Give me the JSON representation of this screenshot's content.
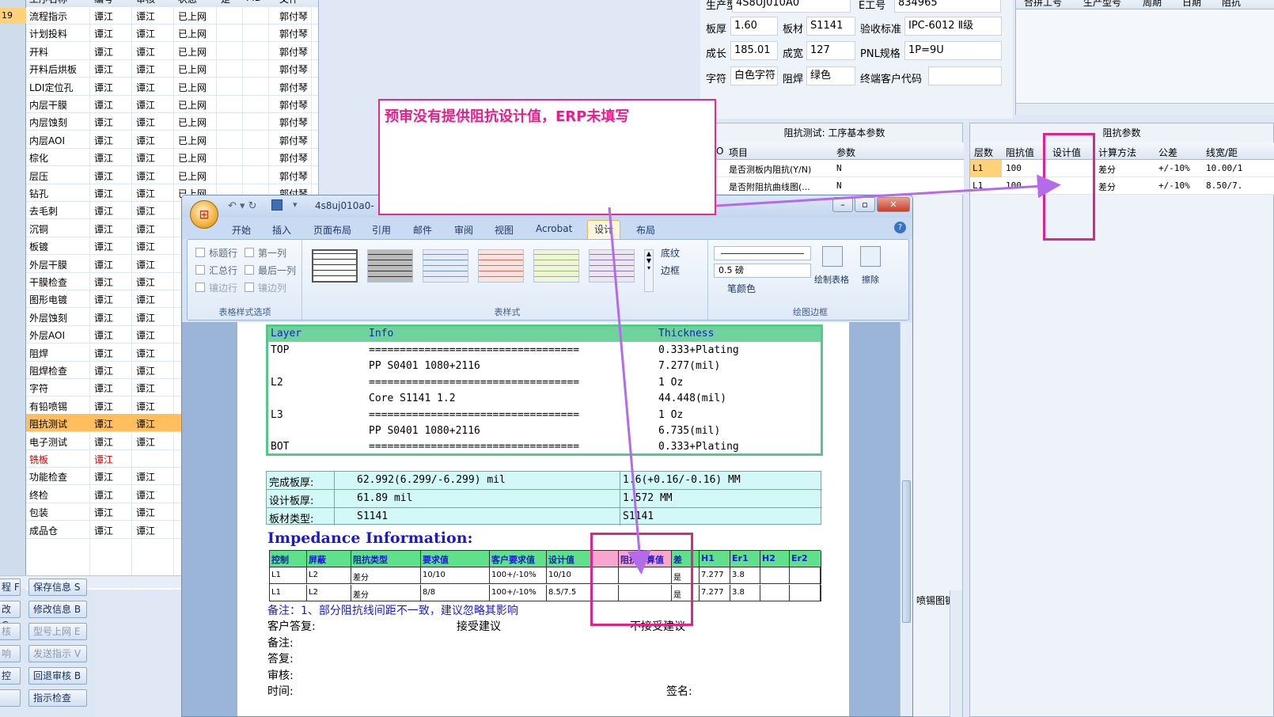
{
  "left_strip": {
    "selected_value": "19"
  },
  "process_grid": {
    "columns": [
      "工序名称",
      "编号",
      "审核",
      "状态",
      "是",
      "PID",
      "文件"
    ],
    "rows": [
      {
        "name": "流程指示",
        "a": "谭江",
        "b": "谭江",
        "c": "已上网",
        "d": "郭付琴"
      },
      {
        "name": "计划投料",
        "a": "谭江",
        "b": "谭江",
        "c": "已上网",
        "d": "郭付琴"
      },
      {
        "name": "开料",
        "a": "谭江",
        "b": "谭江",
        "c": "已上网",
        "d": "郭付琴"
      },
      {
        "name": "开料后烘板",
        "a": "谭江",
        "b": "谭江",
        "c": "已上网",
        "d": "郭付琴"
      },
      {
        "name": "LDI定位孔",
        "a": "谭江",
        "b": "谭江",
        "c": "已上网",
        "d": "郭付琴"
      },
      {
        "name": "内层干膜",
        "a": "谭江",
        "b": "谭江",
        "c": "已上网",
        "d": "郭付琴"
      },
      {
        "name": "内层蚀刻",
        "a": "谭江",
        "b": "谭江",
        "c": "已上网",
        "d": "郭付琴"
      },
      {
        "name": "内层AOI",
        "a": "谭江",
        "b": "谭江",
        "c": "已上网",
        "d": "郭付琴"
      },
      {
        "name": "棕化",
        "a": "谭江",
        "b": "谭江",
        "c": "已上网",
        "d": "郭付琴"
      },
      {
        "name": "层压",
        "a": "谭江",
        "b": "谭江",
        "c": "已上网",
        "d": "郭付琴"
      },
      {
        "name": "钻孔",
        "a": "谭江",
        "b": "谭江",
        "c": "已上网",
        "d": "郭付琴"
      },
      {
        "name": "去毛刺",
        "a": "谭江",
        "b": "谭江",
        "c": "",
        "d": ""
      },
      {
        "name": "沉铜",
        "a": "谭江",
        "b": "谭江",
        "c": "",
        "d": ""
      },
      {
        "name": "板镀",
        "a": "谭江",
        "b": "谭江",
        "c": "",
        "d": ""
      },
      {
        "name": "外层干膜",
        "a": "谭江",
        "b": "谭江",
        "c": "",
        "d": ""
      },
      {
        "name": "干膜检查",
        "a": "谭江",
        "b": "谭江",
        "c": "",
        "d": ""
      },
      {
        "name": "图形电镀",
        "a": "谭江",
        "b": "谭江",
        "c": "",
        "d": ""
      },
      {
        "name": "外层蚀刻",
        "a": "谭江",
        "b": "谭江",
        "c": "",
        "d": ""
      },
      {
        "name": "外层AOI",
        "a": "谭江",
        "b": "谭江",
        "c": "",
        "d": ""
      },
      {
        "name": "阻焊",
        "a": "谭江",
        "b": "谭江",
        "c": "",
        "d": ""
      },
      {
        "name": "阻焊检查",
        "a": "谭江",
        "b": "谭江",
        "c": "",
        "d": ""
      },
      {
        "name": "字符",
        "a": "谭江",
        "b": "谭江",
        "c": "",
        "d": ""
      },
      {
        "name": "有铅喷锡",
        "a": "谭江",
        "b": "谭江",
        "c": "",
        "d": ""
      },
      {
        "name": "阻抗测试",
        "a": "谭江",
        "b": "谭江",
        "c": "",
        "d": "",
        "highlight": true
      },
      {
        "name": "电子测试",
        "a": "谭江",
        "b": "谭江",
        "c": "",
        "d": ""
      },
      {
        "name": "铣板",
        "a": "谭江",
        "b": "",
        "c": "",
        "d": "",
        "red": true
      },
      {
        "name": "功能检查",
        "a": "谭江",
        "b": "谭江",
        "c": "",
        "d": ""
      },
      {
        "name": "终检",
        "a": "谭江",
        "b": "谭江",
        "c": "",
        "d": ""
      },
      {
        "name": "包装",
        "a": "谭江",
        "b": "谭江",
        "c": "",
        "d": ""
      },
      {
        "name": "成品仓",
        "a": "谭江",
        "b": "谭江",
        "c": "",
        "d": ""
      }
    ]
  },
  "left_buttons": [
    {
      "stub": "程 F",
      "label": "保存信息 S",
      "disabled": false
    },
    {
      "stub": "改 C",
      "label": "修改信息 B",
      "disabled": false
    },
    {
      "stub": "核",
      "label": "型号上网 E",
      "disabled": true
    },
    {
      "stub": "响",
      "label": "发送指示 V",
      "disabled": true
    },
    {
      "stub": "控",
      "label": "回退审核 B",
      "disabled": false
    },
    {
      "stub": "",
      "label": "指示检查",
      "disabled": false
    }
  ],
  "top_info": {
    "model_label": "生产型号",
    "model": "4S8UJ010A0",
    "eng_label": "E工号",
    "eng": "834965",
    "thick_label": "板厚",
    "thick": "1.60",
    "mat_label": "板材",
    "mat": "S1141",
    "std_label": "验收标准",
    "std": "IPC-6012 Ⅱ级",
    "len_label": "成长",
    "len": "185.01",
    "wid_label": "成宽",
    "wid": "127",
    "pnl_label": "PNL规格",
    "pnl": "1P=9U",
    "char_label": "字符",
    "char": "白色字符",
    "mask_label": "阻焊",
    "mask": "绿色",
    "cust_label": "终端客户代码",
    "cust": ""
  },
  "top_right": {
    "cols": [
      "合拼工号",
      "生产型号",
      "周期",
      "日期",
      "阻抗"
    ]
  },
  "mid_panel": {
    "title": "阻抗测试: 工序基本参数",
    "cols": [
      "NO",
      "项目",
      "参数"
    ],
    "rows": [
      {
        "item": "是否测板内阻抗(Y/N)",
        "val": "N"
      },
      {
        "item": "是否附阻抗曲线图(...",
        "val": "N"
      }
    ],
    "bottom_label": "喷锡图镀"
  },
  "right_panel": {
    "title": "阻抗参数",
    "cols": [
      "层数",
      "阻抗值",
      "设计值",
      "计算方法",
      "公差",
      "线宽/距"
    ],
    "rows": [
      {
        "layer": "L1",
        "imp": "100",
        "design": "",
        "method": "差分",
        "tol": "+/-10%",
        "line": "10.00/1"
      },
      {
        "layer": "L1",
        "imp": "100",
        "design": "",
        "method": "差分",
        "tol": "+/-10%",
        "line": "8.50/7."
      }
    ]
  },
  "word": {
    "title": "4s8uj010a0-",
    "tabs": [
      "开始",
      "插入",
      "页面布局",
      "引用",
      "邮件",
      "审阅",
      "视图",
      "Acrobat",
      "设计",
      "布局"
    ],
    "active_tab": "设计",
    "style_opts": [
      "标题行",
      "第一列",
      "汇总行",
      "最后一列",
      "镶边行",
      "镶边列"
    ],
    "groups": [
      "表格样式选项",
      "表样式",
      "绘图边框"
    ],
    "shading": "底纹",
    "border": "边框",
    "pen_weight": "0.5 磅",
    "pen_color": "笔颜色",
    "draw_table": "绘制表格",
    "eraser": "擦除"
  },
  "doc": {
    "layer_head": [
      "Layer",
      "Info",
      "Thickness"
    ],
    "layer_rows": [
      {
        "layer": "TOP",
        "info": "==================================",
        "thick": "0.333+Plating"
      },
      {
        "layer": "",
        "info": "PP      S0401     1080+2116",
        "thick": "7.277(mil)"
      },
      {
        "layer": "L2",
        "info": "==================================",
        "thick": "1 Oz"
      },
      {
        "layer": "",
        "info": "Core      S1141     1.2",
        "thick": "44.448(mil)"
      },
      {
        "layer": "L3",
        "info": "==================================",
        "thick": "1 Oz"
      },
      {
        "layer": "",
        "info": "PP      S0401     1080+2116",
        "thick": "6.735(mil)"
      },
      {
        "layer": "BOT",
        "info": "==================================",
        "thick": "0.333+Plating"
      }
    ],
    "info_rows": [
      {
        "label": "完成板厚:",
        "a": "62.992(6.299/-6.299) mil",
        "b": "1.6(+0.16/-0.16) MM"
      },
      {
        "label": "设计板厚:",
        "a": "61.89 mil",
        "b": "1.572 MM"
      },
      {
        "label": "板材类型:",
        "a": "S1141",
        "b": "S1141"
      }
    ],
    "imp_title": "Impedance Information:",
    "imp_head": [
      "控制",
      "屏蔽",
      "阻抗类型",
      "要求值",
      "客户要求值",
      "设计值",
      "",
      "阻抗计算值",
      "差",
      "H1",
      "Er1",
      "H2",
      "Er2"
    ],
    "imp_rows": [
      [
        "L1",
        "L2",
        "差分",
        "10/10",
        "100+/-10%",
        "10/10",
        "",
        "",
        "是",
        "7.277",
        "3.8",
        "",
        ""
      ],
      [
        "L1",
        "L2",
        "差分",
        "8/8",
        "100+/-10%",
        "8.5/7.5",
        "",
        "",
        "是",
        "7.277",
        "3.8",
        "",
        ""
      ]
    ],
    "remark": "备注：1、部分阻抗线间距不一致，建议忽略其影响",
    "reply_label": "客户答复:",
    "accept": "接受建议",
    "reject": "不接受建议",
    "note_label": "备注:",
    "answer_label": "答复:",
    "audit_label": "审核:",
    "time_label": "时间:",
    "sign_label": "签名:"
  },
  "annotation": {
    "text": "预审没有提供阻抗设计值，ERP未填写",
    "color": "#e4208c"
  }
}
